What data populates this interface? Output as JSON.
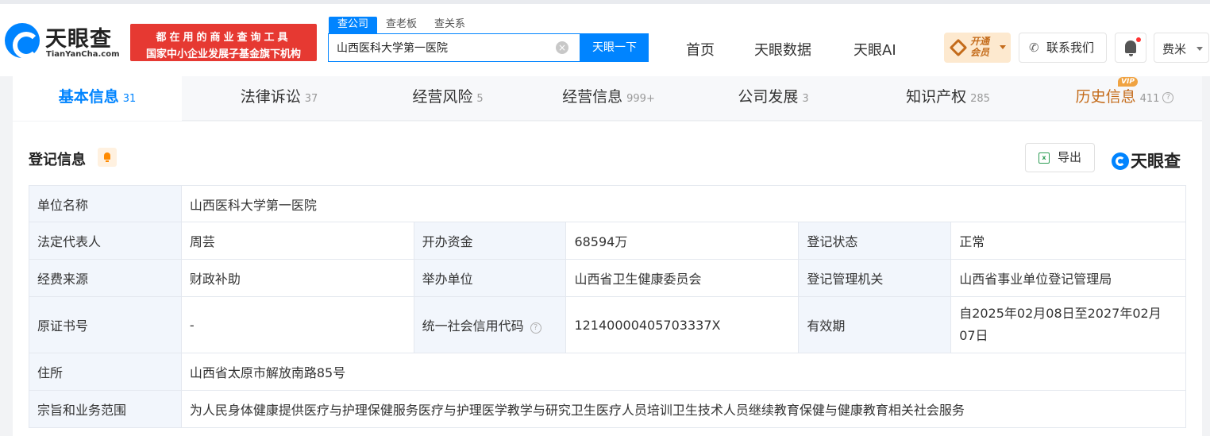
{
  "header": {
    "logo_title": "天眼查",
    "logo_sub": "TianYanCha.com",
    "slogan_line1": "都在用的商业查询工具",
    "slogan_line2": "国家中小企业发展子基金旗下机构",
    "search_tabs": [
      "查公司",
      "查老板",
      "查关系"
    ],
    "search_value": "山西医科大学第一医院",
    "clear_icon": "×",
    "search_button": "天眼一下",
    "nav": [
      "首页",
      "天眼数据",
      "天眼AI"
    ],
    "vip_line1": "开通",
    "vip_line2": "会员",
    "contact_icon": "✆",
    "contact_label": "联系我们",
    "user_name": "费米"
  },
  "tabs": [
    {
      "label": "基本信息",
      "count": "31"
    },
    {
      "label": "法律诉讼",
      "count": "37"
    },
    {
      "label": "经营风险",
      "count": "5"
    },
    {
      "label": "经营信息",
      "count": "999+"
    },
    {
      "label": "公司发展",
      "count": "3"
    },
    {
      "label": "知识产权",
      "count": "285"
    },
    {
      "label": "历史信息",
      "count": "411"
    }
  ],
  "vip_badge": "VIP",
  "help_mark": "?",
  "section": {
    "title": "登记信息",
    "export_icon": "x",
    "export_label": "导出",
    "brand": "天眼查"
  },
  "info": {
    "unit_name_label": "单位名称",
    "unit_name": "山西医科大学第一医院",
    "legal_rep_label": "法定代表人",
    "legal_rep": "周芸",
    "capital_label": "开办资金",
    "capital": "68594万",
    "status_label": "登记状态",
    "status": "正常",
    "funding_label": "经费来源",
    "funding": "财政补助",
    "organizer_label": "举办单位",
    "organizer": "山西省卫生健康委员会",
    "authority_label": "登记管理机关",
    "authority": "山西省事业单位登记管理局",
    "cert_label": "原证书号",
    "cert": "-",
    "credit_code_label": "统一社会信用代码",
    "credit_code": "12140000405703337X",
    "validity_label": "有效期",
    "validity": "自2025年02月08日至2027年02月07日",
    "address_label": "住所",
    "address": "山西省太原市解放南路85号",
    "scope_label": "宗旨和业务范围",
    "scope": "为人民身体健康提供医疗与护理保健服务医疗与护理医学教学与研究卫生医疗人员培训卫生技术人员继续教育保健与健康教育相关社会服务"
  },
  "colors": {
    "accent": "#0084ff",
    "slogan_bg": "#e63932",
    "history": "#c46b1a"
  }
}
